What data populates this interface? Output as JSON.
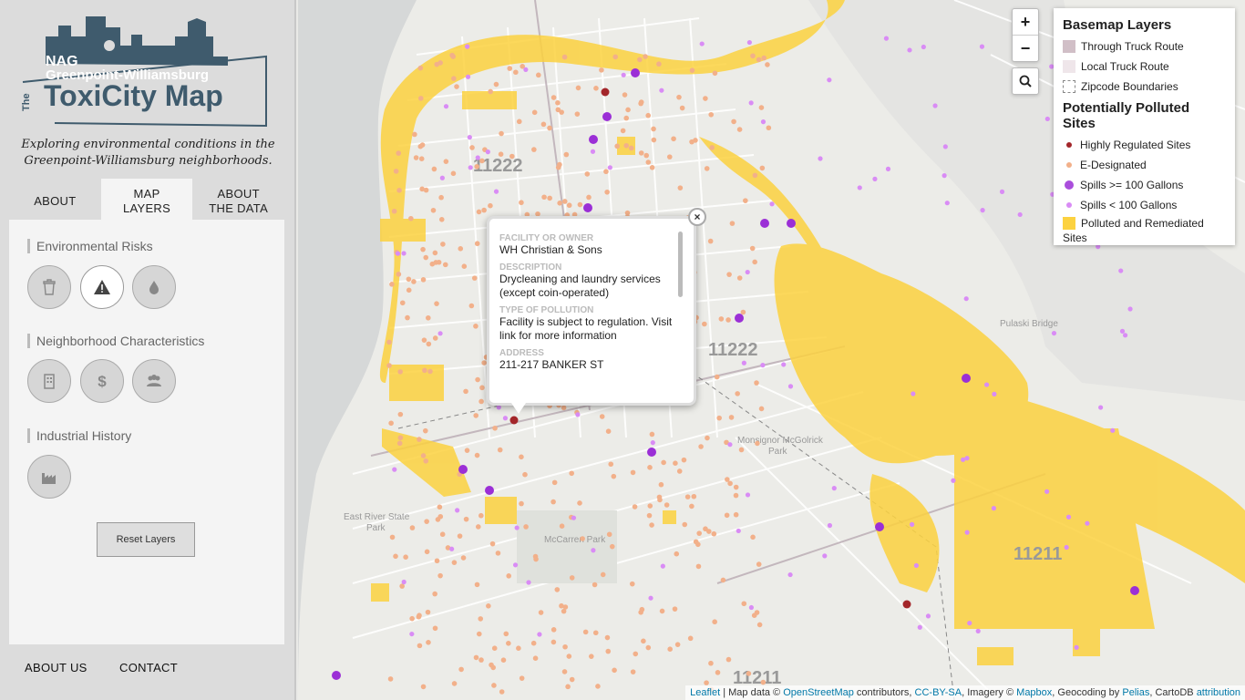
{
  "logo": {
    "org": "NAG",
    "line1": "Greenpoint-Williamsburg",
    "the": "The",
    "title": "ToxiCity Map"
  },
  "tagline": {
    "line1": "Exploring environmental conditions in the",
    "line2": "Greenpoint-Williamsburg neighborhoods."
  },
  "tabs": {
    "about": "ABOUT",
    "map_layers_1": "MAP",
    "map_layers_2": "LAYERS",
    "about_data_1": "ABOUT",
    "about_data_2": "THE DATA"
  },
  "panel": {
    "environmental": "Environmental Risks",
    "neighborhood": "Neighborhood Characteristics",
    "industrial": "Industrial History",
    "reset": "Reset Layers"
  },
  "bottom_nav": {
    "about_us": "ABOUT US",
    "contact": "CONTACT"
  },
  "zoom": {
    "in": "+",
    "out": "−"
  },
  "legend": {
    "basemap_title": "Basemap Layers",
    "through_truck": "Through Truck Route",
    "local_truck": "Local Truck Route",
    "zipcode": "Zipcode Boundaries",
    "polluted_title": "Potentially Polluted Sites",
    "highly_regulated": "Highly Regulated Sites",
    "e_designated": "E-Designated",
    "spills_large": "Spills >= 100 Gallons",
    "spills_small": "Spills < 100 Gallons",
    "polluted_remediated_1": "Polluted and Remediated",
    "polluted_remediated_2": "Sites"
  },
  "popup": {
    "close": "×",
    "facility_label": "FACILITY OR OWNER",
    "facility_value": "WH Christian & Sons",
    "description_label": "DESCRIPTION",
    "description_value": "Drycleaning and laundry services (except coin-operated)",
    "type_label": "TYPE OF POLLUTION",
    "type_value": "Facility is subject to regulation. Visit link for more information",
    "address_label": "ADDRESS",
    "address_value": "211-217 BANKER ST"
  },
  "map_labels": {
    "zip_11222_a": "11222",
    "zip_11222_b": "11222",
    "zip_11211_a": "11211",
    "zip_11211_b": "11211",
    "mccarren": "McCarren Park",
    "monsignor_1": "Monsignor McGolrick",
    "monsignor_2": "Park",
    "east_river_1": "East River State",
    "east_river_2": "Park",
    "pulaski": "Pulaski Bridge"
  },
  "colors": {
    "regulated": "#a3262a",
    "e_designated": "#f2b08a",
    "spill_large": "#9b2fd6",
    "spill_small": "#d98cf5",
    "polluted": "#fcd240",
    "water": "#d6d8d8"
  },
  "attribution": {
    "leaflet": "Leaflet",
    "text1": " | Map data © ",
    "osm": "OpenStreetMap",
    "text2": " contributors, ",
    "cc": "CC-BY-SA",
    "text3": ", Imagery © ",
    "mapbox": "Mapbox",
    "text4": ", Geocoding by ",
    "pelias": "Pelias",
    "text5": ", CartoDB ",
    "attr": "attribution"
  }
}
